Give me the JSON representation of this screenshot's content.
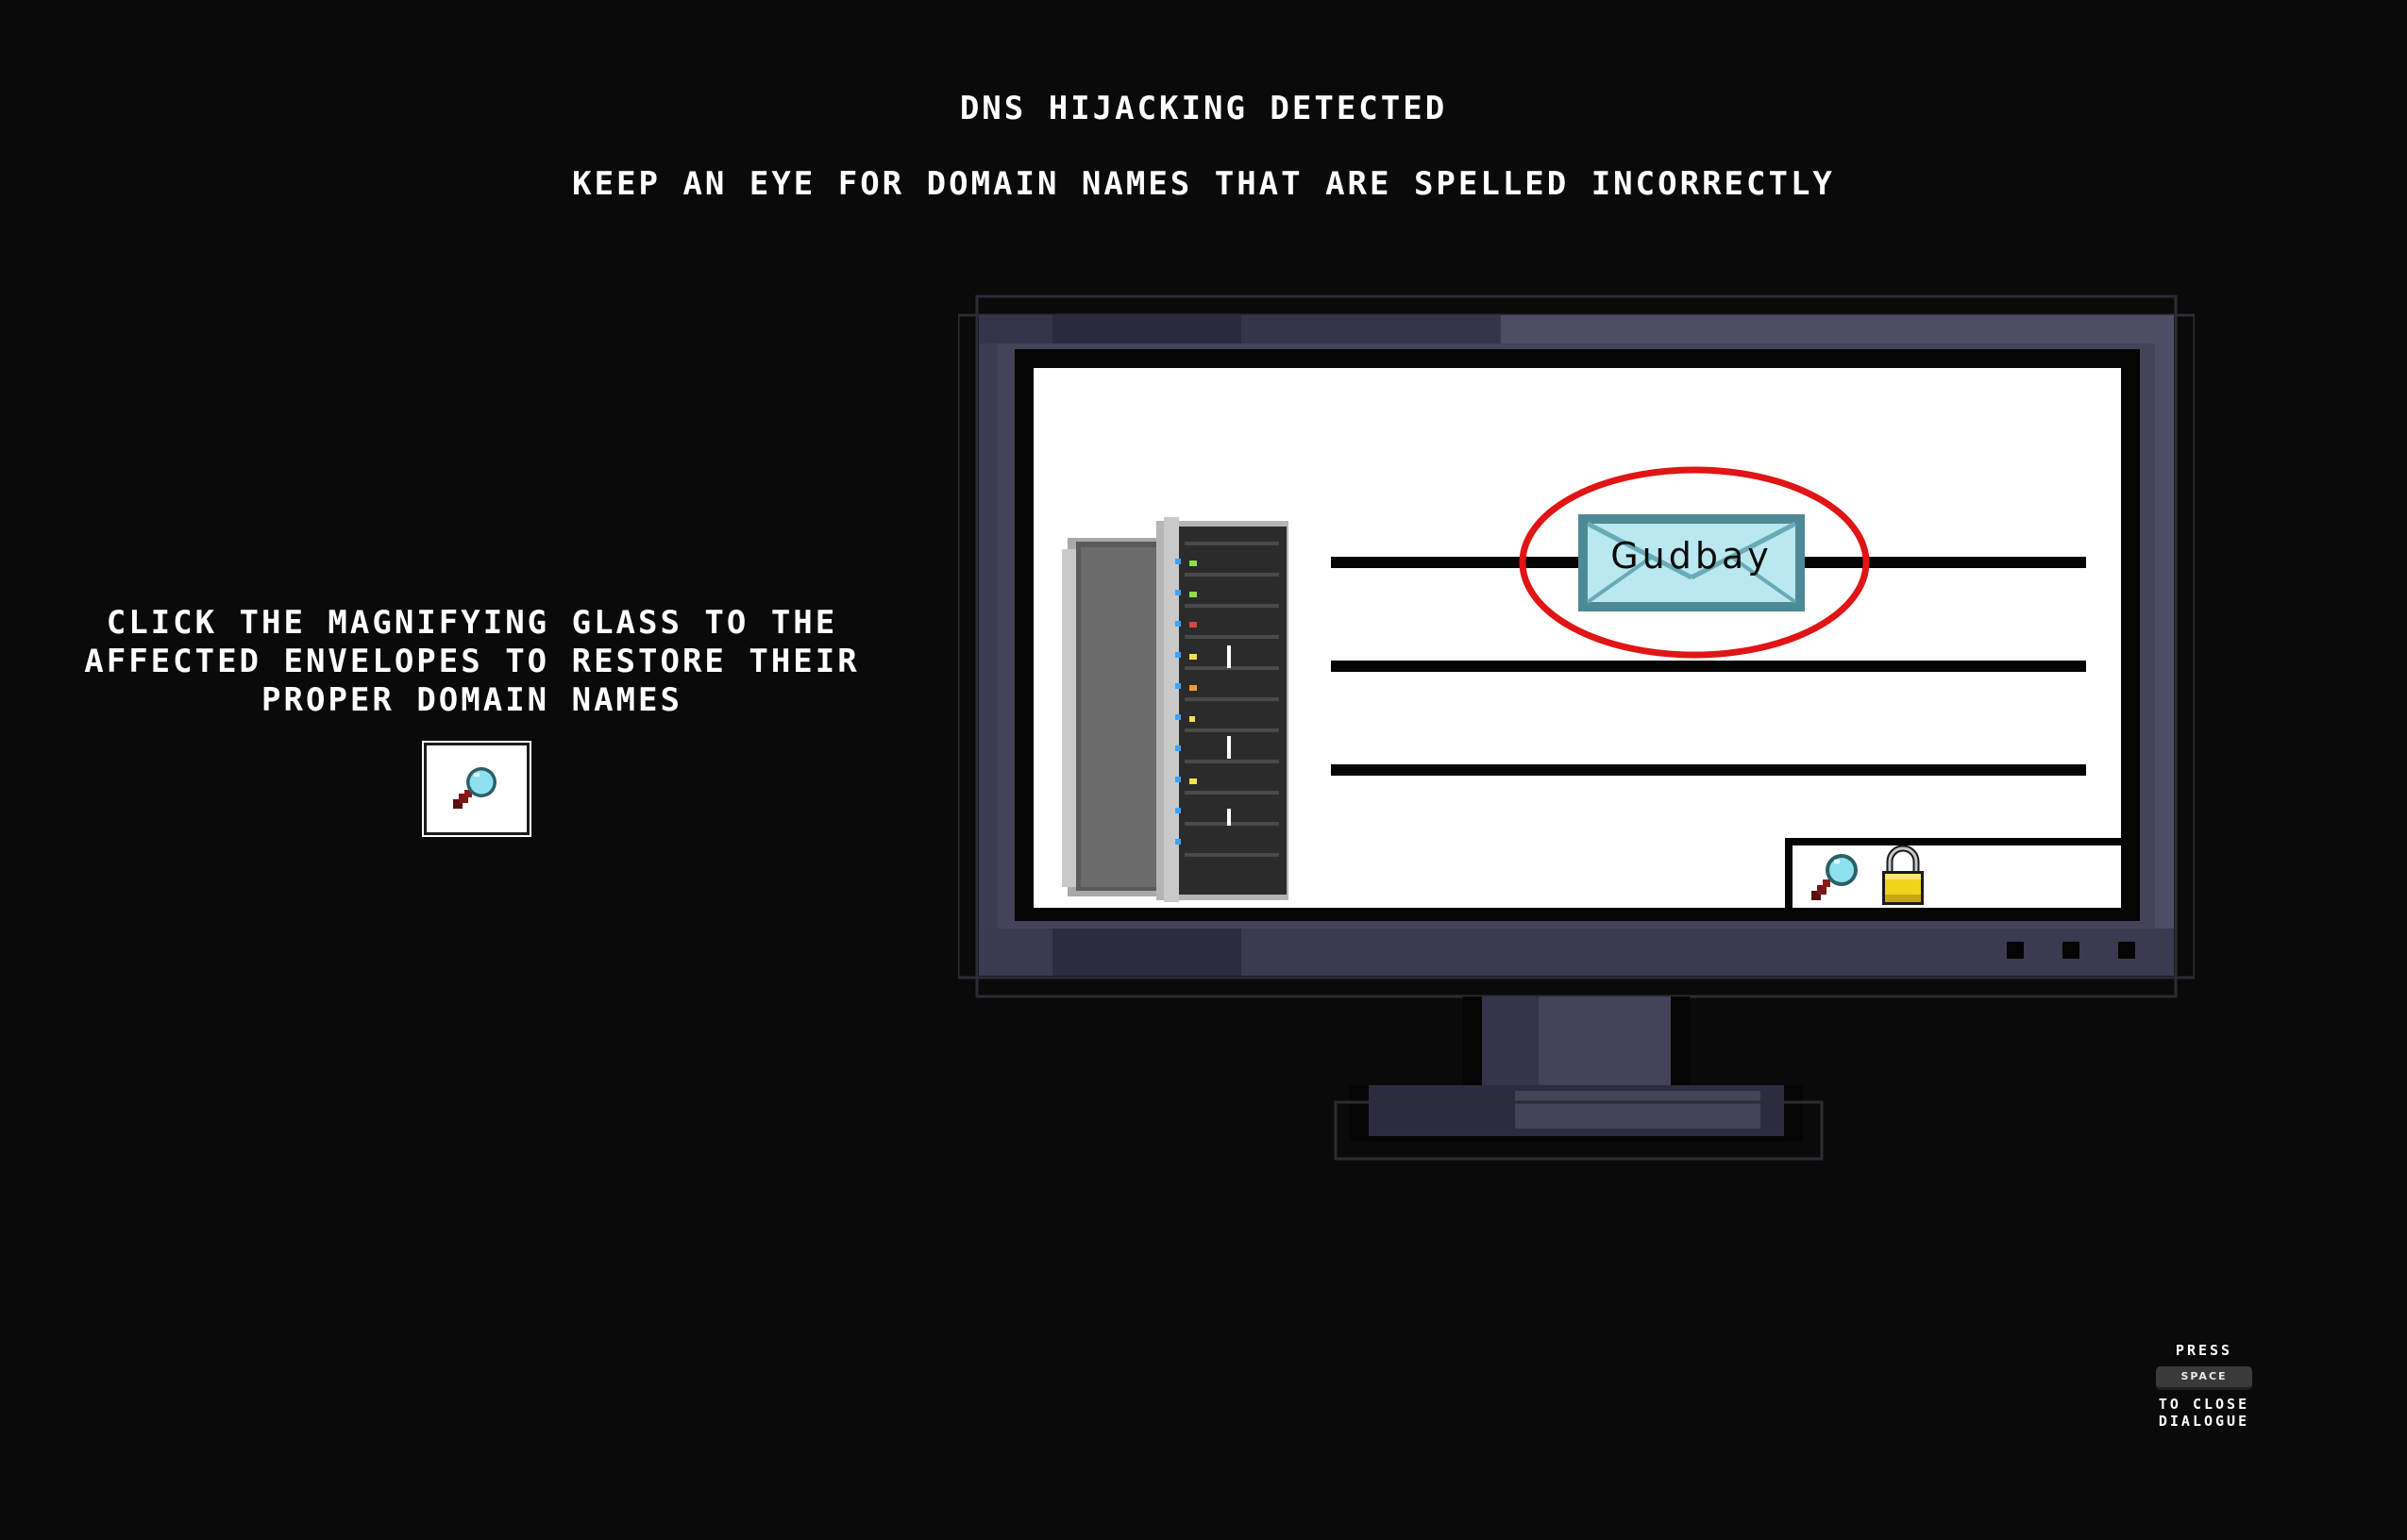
{
  "header": {
    "title": "DNS HIJACKING DETECTED",
    "subtitle": "KEEP AN EYE FOR DOMAIN NAMES THAT ARE SPELLED INCORRECTLY"
  },
  "instruction": {
    "text": "CLICK THE MAGNIFYING GLASS TO THE AFFECTED ENVELOPES TO RESTORE THEIR PROPER DOMAIN NAMES"
  },
  "tool": {
    "icon": "magnifying-glass-icon"
  },
  "monitor_screen": {
    "envelope_label": "Gudbay",
    "envelope_highlight_color": "#e01515",
    "taskbar_icons": [
      "magnifying-glass-icon",
      "padlock-icon"
    ]
  },
  "hint": {
    "press_label": "PRESS",
    "key_label": "SPACE",
    "action_label": "TO CLOSE DIALOGUE"
  },
  "colors": {
    "background": "#0a0a0a",
    "monitor_bezel": "#43435a",
    "screen": "#ffffff",
    "envelope": "#b9e8f0",
    "highlight": "#e01515",
    "lock": "#f1d21c"
  }
}
